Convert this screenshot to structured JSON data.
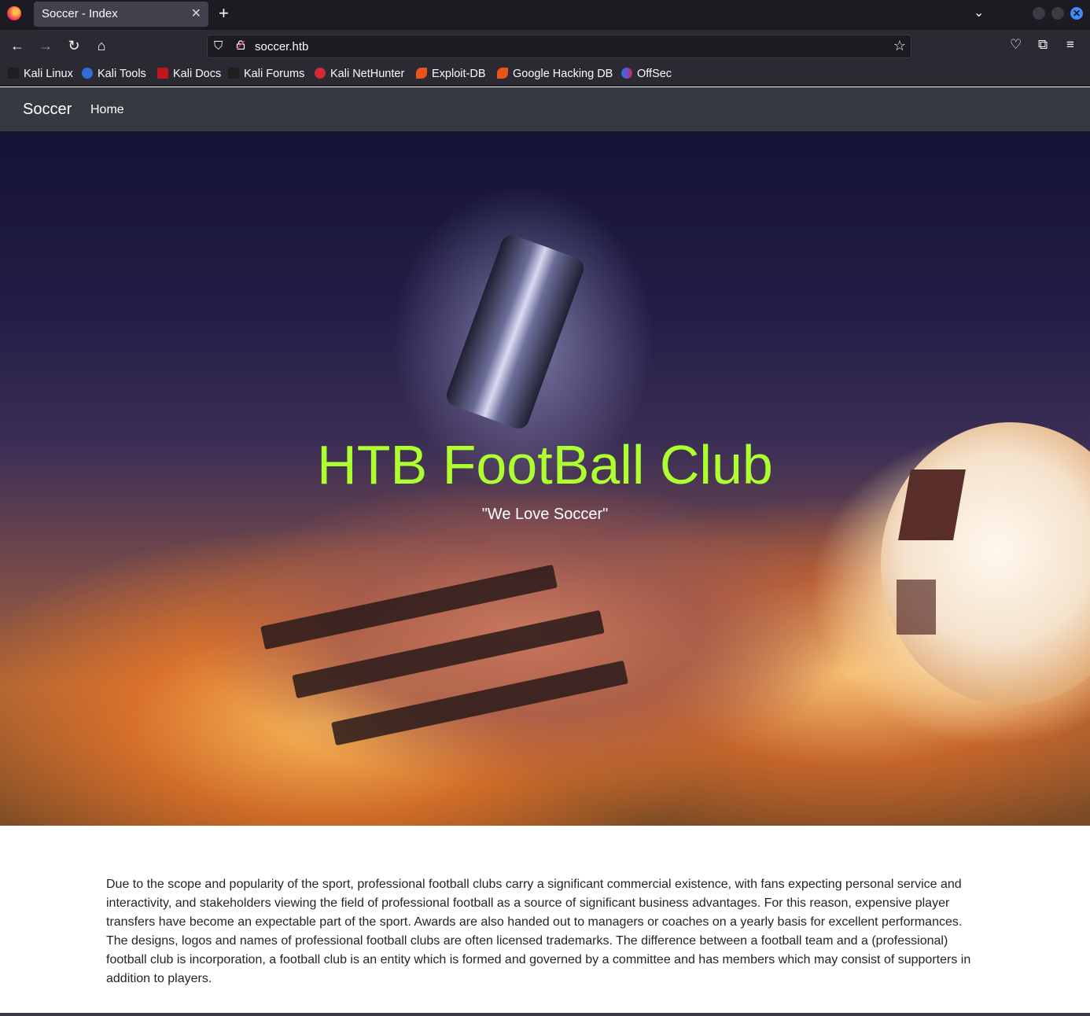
{
  "browser": {
    "tab": {
      "title": "Soccer - Index"
    },
    "url": "soccer.htb",
    "bookmarks": [
      {
        "label": "Kali Linux",
        "icon": "kali-dragon-icon",
        "color": "#1f1f1f"
      },
      {
        "label": "Kali Tools",
        "icon": "kali-tools-icon",
        "color": "#2f6fd6"
      },
      {
        "label": "Kali Docs",
        "icon": "kali-docs-icon",
        "color": "#c0161f"
      },
      {
        "label": "Kali Forums",
        "icon": "kali-forums-icon",
        "color": "#1f1f1f"
      },
      {
        "label": "Kali NetHunter",
        "icon": "kali-nethunter-icon",
        "color": "#d42a35"
      },
      {
        "label": "Exploit-DB",
        "icon": "exploit-db-icon",
        "color": "#e9541d"
      },
      {
        "label": "Google Hacking DB",
        "icon": "ghdb-icon",
        "color": "#e9541d"
      },
      {
        "label": "OffSec",
        "icon": "offsec-icon",
        "color": "#6b4fd6"
      }
    ]
  },
  "site": {
    "brand": "Soccer",
    "nav": {
      "home": "Home"
    },
    "hero": {
      "title": "HTB FootBall Club",
      "subtitle": "\"We Love Soccer\"",
      "title_color": "#adff2f"
    },
    "body_text": "Due to the scope and popularity of the sport, professional football clubs carry a significant commercial existence, with fans expecting personal service and interactivity, and stakeholders viewing the field of professional football as a source of significant business advantages. For this reason, expensive player transfers have become an expectable part of the sport. Awards are also handed out to managers or coaches on a yearly basis for excellent performances. The designs, logos and names of professional football clubs are often licensed trademarks. The difference between a football team and a (professional) football club is incorporation, a football club is an entity which is formed and governed by a committee and has members which may consist of supporters in addition to players."
  }
}
